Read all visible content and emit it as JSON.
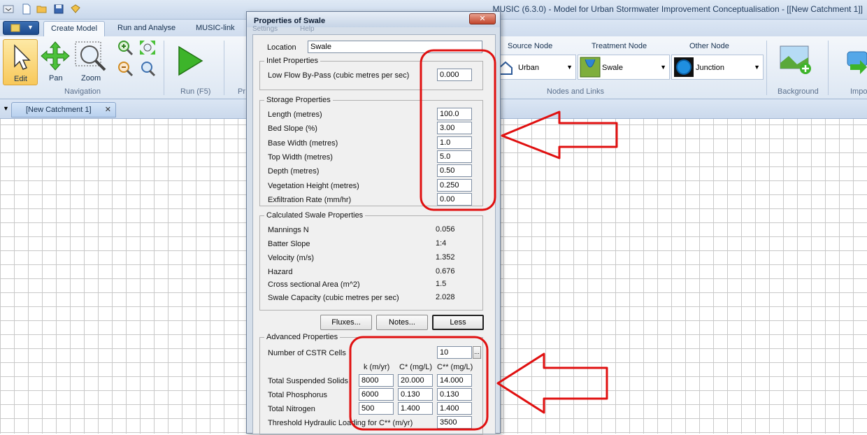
{
  "window": {
    "title": "MUSIC (6.3.0) - Model for Urban Stormwater Improvement Conceptualisation - [[New Catchment 1]]"
  },
  "ribbon": {
    "tabs": [
      "Create Model",
      "Run and Analyse",
      "MUSIC-link"
    ],
    "groups": {
      "navigation": "Navigation",
      "run": "Run (F5)",
      "run_partial": "Pr",
      "nodes": "Nodes and Links",
      "background": "Background",
      "import_partial": "Impo"
    },
    "buttons": {
      "edit": "Edit",
      "pan": "Pan",
      "zoom": "Zoom"
    },
    "node_types": {
      "source": {
        "heading": "Source Node",
        "value": "Urban"
      },
      "treatment": {
        "heading": "Treatment Node",
        "value": "Swale"
      },
      "other": {
        "heading": "Other Node",
        "value": "Junction"
      }
    }
  },
  "document_tab": {
    "label": "[New Catchment 1]",
    "close": "✕"
  },
  "dialog": {
    "title": "Properties of Swale",
    "close": "✕",
    "ghost_menu": [
      "Settings",
      "Help"
    ],
    "location_label": "Location",
    "location_value": "Swale",
    "inlet": {
      "title": "Inlet Properties",
      "low_flow_label": "Low Flow By-Pass (cubic metres per sec)",
      "low_flow_value": "0.000"
    },
    "storage": {
      "title": "Storage Properties",
      "rows": [
        {
          "label": "Length (metres)",
          "value": "100.0"
        },
        {
          "label": "Bed Slope (%)",
          "value": "3.00"
        },
        {
          "label": "Base Width (metres)",
          "value": "1.0"
        },
        {
          "label": "Top Width (metres)",
          "value": "5.0"
        },
        {
          "label": "Depth (metres)",
          "value": "0.50"
        },
        {
          "label": "Vegetation Height (metres)",
          "value": "0.250"
        },
        {
          "label": "Exfiltration Rate (mm/hr)",
          "value": "0.00"
        }
      ]
    },
    "calculated": {
      "title": "Calculated Swale Properties",
      "rows": [
        {
          "label": "Mannings N",
          "value": "0.056"
        },
        {
          "label": "Batter Slope",
          "value": "1:4"
        },
        {
          "label": "Velocity (m/s)",
          "value": "1.352"
        },
        {
          "label": "Hazard",
          "value": "0.676"
        },
        {
          "label": "Cross sectional Area (m^2)",
          "value": "1.5"
        },
        {
          "label": "Swale Capacity (cubic metres per sec)",
          "value": "2.028"
        }
      ]
    },
    "buttons": {
      "fluxes": "Fluxes...",
      "notes": "Notes...",
      "less": "Less"
    },
    "advanced": {
      "title": "Advanced Properties",
      "cstr_label": "Number of CSTR Cells",
      "cstr_value": "10",
      "ellipsis": "...",
      "columns": [
        "k (m/yr)",
        "C* (mg/L)",
        "C** (mg/L)"
      ],
      "pollutants": [
        {
          "label": "Total Suspended Solids",
          "k": "8000",
          "c1": "20.000",
          "c2": "14.000"
        },
        {
          "label": "Total Phosphorus",
          "k": "6000",
          "c1": "0.130",
          "c2": "0.130"
        },
        {
          "label": "Total Nitrogen",
          "k": "500",
          "c1": "1.400",
          "c2": "1.400"
        }
      ],
      "threshold_label": "Threshold Hydraulic Loading for C** (m/yr)",
      "threshold_value": "3500"
    }
  },
  "colors": {
    "annotation": "#e01010",
    "ribbon_bg": "#dde7f3",
    "dialog_bg": "#f0f0f0",
    "grid_line": "#c9c9c9"
  },
  "icons": [
    "new-file-icon",
    "open-folder-icon",
    "save-icon",
    "brush-icon",
    "cursor-icon",
    "pan-arrows-icon",
    "zoom-magnifier-icon",
    "zoom-in-icon",
    "zoom-out-icon",
    "zoom-extent-icon",
    "zoom-window-icon",
    "play-icon",
    "house-icon",
    "swale-icon",
    "junction-icon",
    "background-image-icon",
    "import-icon"
  ]
}
